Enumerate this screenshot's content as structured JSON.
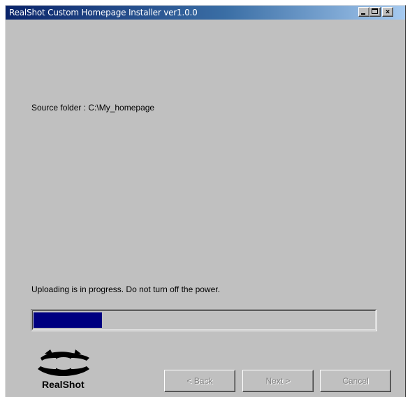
{
  "window": {
    "title": "RealShot Custom Homepage Installer ver1.0.0",
    "controls": {
      "minimize": "minimize",
      "maximize": "maximize",
      "close": "×"
    }
  },
  "main": {
    "source_folder_text": "Source folder : C:\\My_homepage",
    "status_text": "Uploading is in progress. Do not turn off the power.",
    "progress_fraction": 0.2
  },
  "logo": {
    "text": "RealShot",
    "icon": "realshot-logo-icon"
  },
  "buttons": {
    "back": "< Back",
    "next": "Next >",
    "cancel": "Cancel"
  },
  "colors": {
    "title_bar_start": "#0a246a",
    "title_bar_end": "#a6caf0",
    "progress_fill": "#000080",
    "dialog_bg": "#c0c0c0"
  }
}
